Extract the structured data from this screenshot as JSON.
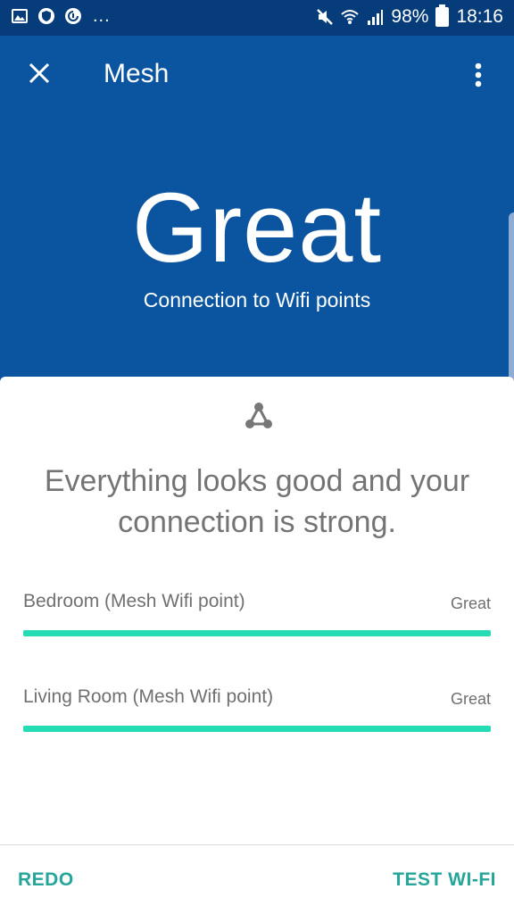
{
  "status_bar": {
    "dots": "...",
    "battery": "98%",
    "time": "18:16"
  },
  "app_bar": {
    "title": "Mesh"
  },
  "hero": {
    "headline": "Great",
    "subtitle": "Connection to Wifi points"
  },
  "card": {
    "summary": "Everything looks good and your connection is strong.",
    "points": [
      {
        "label": "Bedroom (Mesh Wifi point)",
        "status": "Great",
        "strength": 1.0
      },
      {
        "label": "Living Room (Mesh Wifi point)",
        "status": "Great",
        "strength": 1.0
      }
    ]
  },
  "actions": {
    "redo": "REDO",
    "test": "TEST WI-FI"
  },
  "colors": {
    "header_bg": "#0b55a0",
    "status_bar_bg": "#063c7a",
    "accent": "#26a69a",
    "bar_fill": "#26dcb4"
  }
}
